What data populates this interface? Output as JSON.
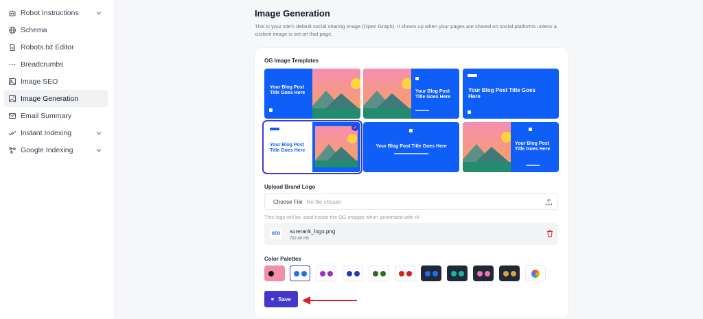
{
  "sidebar": {
    "items": [
      {
        "label": "Robot Instructions",
        "icon": "robot-icon",
        "chevron": true
      },
      {
        "label": "Schema",
        "icon": "globe-icon"
      },
      {
        "label": "Robots.txt Editor",
        "icon": "file-text-icon"
      },
      {
        "label": "Breadcrumbs",
        "icon": "ellipsis-icon"
      },
      {
        "label": "Image SEO",
        "icon": "image-icon"
      },
      {
        "label": "Image Generation",
        "icon": "image-sparkle-icon",
        "active": true
      },
      {
        "label": "Email Summary",
        "icon": "mail-icon"
      },
      {
        "label": "Instant Indexing",
        "icon": "check-double-icon",
        "chevron": true
      },
      {
        "label": "Google Indexing",
        "icon": "network-icon",
        "chevron": true
      }
    ]
  },
  "page": {
    "title": "Image Generation",
    "description": "This is your site's default social sharing image (Open Graph). It shows up when your pages are shared on social platforms unless a custom image is set on that page."
  },
  "templates": {
    "label": "OG Image Templates",
    "title_text": "Your Blog Post Title Goes Here",
    "selected_index": 3
  },
  "logo": {
    "label": "Upload Brand Logo",
    "choose_button": "Choose File",
    "no_file": "No file chosen",
    "hint": "This logo will be used inside the OG images when generated with AI",
    "file_name": "surerank_logo.png",
    "file_size": "782.46 KB",
    "thumb_text": "SEO"
  },
  "palettes": {
    "label": "Color Palettes",
    "items": [
      {
        "bg": "#f28fa7",
        "dots": [
          "#111111",
          "#f28fa7"
        ]
      },
      {
        "bg": "#ffffff",
        "dots": [
          "#1d6ff2",
          "#1d6ff2"
        ],
        "selected": true
      },
      {
        "bg": "#ffffff",
        "dots": [
          "#9b30c8",
          "#9b30c8"
        ]
      },
      {
        "bg": "#ffffff",
        "dots": [
          "#1e3bb8",
          "#1e3bb8"
        ]
      },
      {
        "bg": "#ffffff",
        "dots": [
          "#2f6b1e",
          "#2f6b1e"
        ]
      },
      {
        "bg": "#ffffff",
        "dots": [
          "#d81e1e",
          "#d81e1e"
        ]
      },
      {
        "bg": "#1f2937",
        "dots": [
          "#1d6ff2",
          "#1d6ff2"
        ]
      },
      {
        "bg": "#1f2937",
        "dots": [
          "#14b8a6",
          "#14b8a6"
        ]
      },
      {
        "bg": "#1f2937",
        "dots": [
          "#f472b6",
          "#f472b6"
        ]
      },
      {
        "bg": "#1f2937",
        "dots": [
          "#d9a441",
          "#d9a441"
        ]
      },
      {
        "bg": "#ffffff",
        "dots": [
          "rainbow"
        ]
      }
    ]
  },
  "save_label": "Save",
  "colors": {
    "accent": "#4338ca",
    "template_blue": "#0f5ef7",
    "danger": "#dc2626"
  }
}
